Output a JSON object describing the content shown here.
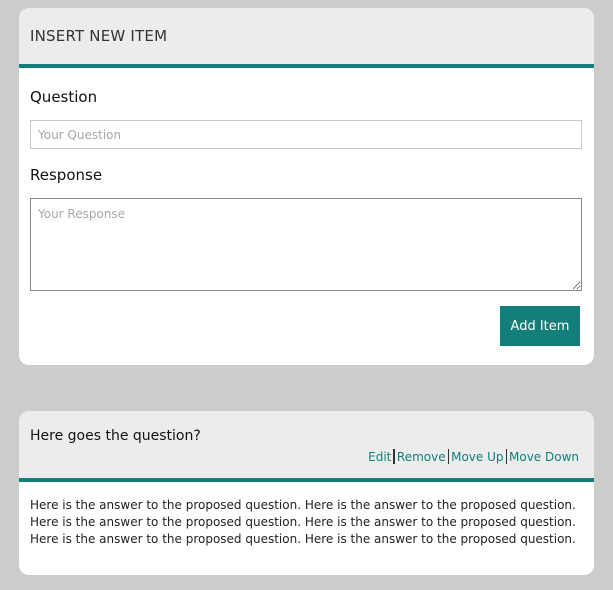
{
  "insert_form": {
    "title": "INSERT NEW ITEM",
    "question_label": "Question",
    "question_placeholder": "Your Question",
    "response_label": "Response",
    "response_placeholder": "Your Response",
    "add_button_label": "Add Item"
  },
  "item": {
    "question": "Here goes the question?",
    "actions": {
      "edit": "Edit",
      "remove": "Remove",
      "move_up": "Move Up",
      "move_down": "Move Down"
    },
    "answer": "Here is the answer to the proposed question. Here is the answer to the proposed question. Here is the answer to the proposed question. Here is the answer to the proposed question. Here is the answer to the proposed question. Here is the answer to the proposed question."
  },
  "colors": {
    "accent": "#127f7a",
    "page_background": "#cccccc",
    "header_background": "#ececec"
  }
}
